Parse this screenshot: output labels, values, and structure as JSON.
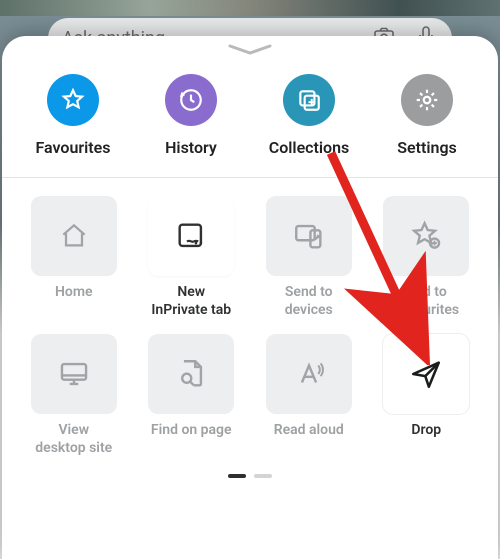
{
  "searchbar": {
    "placeholder": "Ask anything"
  },
  "colors": {
    "blue": "#0b98e8",
    "purple": "#8a6ccf",
    "teal": "#2996b8",
    "gray": "#9b9d9f"
  },
  "topRow": {
    "items": [
      {
        "label": "Favourites"
      },
      {
        "label": "History"
      },
      {
        "label": "Collections"
      },
      {
        "label": "Settings"
      }
    ]
  },
  "grid": {
    "items": [
      {
        "label": "Home"
      },
      {
        "label": "New\nInPrivate tab"
      },
      {
        "label": "Send to\ndevices"
      },
      {
        "label": "Add to\nFavourites"
      },
      {
        "label": "View\ndesktop site"
      },
      {
        "label": "Find on page"
      },
      {
        "label": "Read aloud"
      },
      {
        "label": "Drop"
      }
    ]
  },
  "pager": {
    "count": 2,
    "active": 0
  }
}
